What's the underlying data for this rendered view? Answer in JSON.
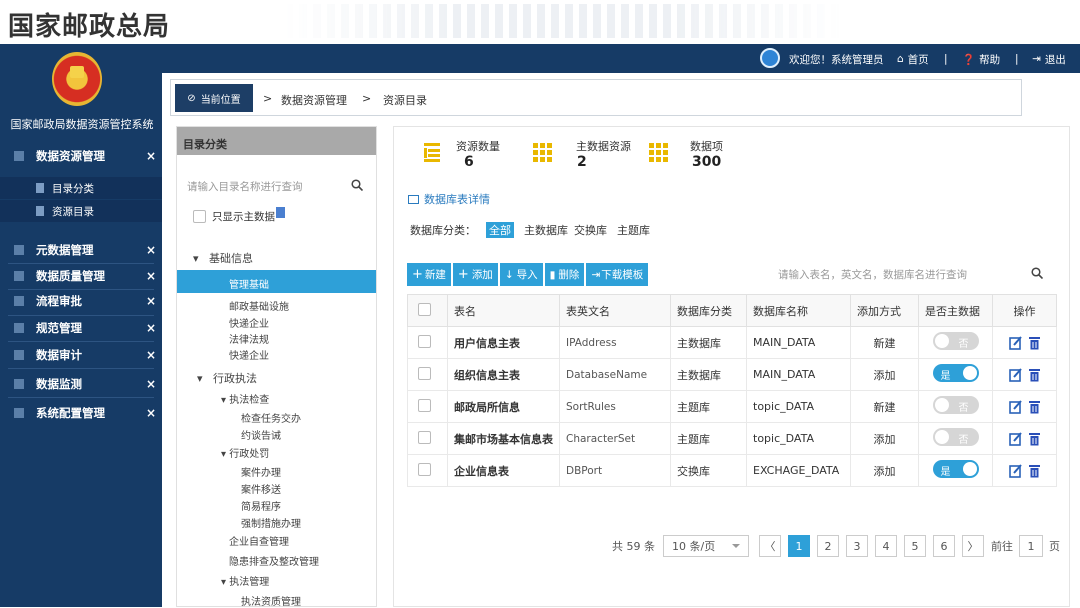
{
  "banner": {
    "title": "国家邮政总局"
  },
  "sidebar": {
    "system_name": "国家邮政局数据资源管控系统",
    "menus": [
      {
        "label": "数据资源管理",
        "close": "×"
      },
      {
        "label": "元数据管理",
        "close": "×"
      },
      {
        "label": "数据质量管理",
        "close": "×"
      },
      {
        "label": "流程审批",
        "close": "×"
      },
      {
        "label": "规范管理",
        "close": "×"
      },
      {
        "label": "数据审计",
        "close": "×"
      },
      {
        "label": "数据监测",
        "close": "×"
      },
      {
        "label": "系统配置管理",
        "close": "×"
      }
    ],
    "submenus": [
      {
        "label": "目录分类"
      },
      {
        "label": "资源目录"
      }
    ]
  },
  "topbar": {
    "welcome": "欢迎您！系统管理员",
    "home": "首页",
    "help": "帮助",
    "logout": "退出",
    "sep": "|"
  },
  "breadcrumb": {
    "current_label": "当前位置",
    "items": [
      "数据资源管理",
      "资源目录"
    ],
    "sep": ">"
  },
  "tree": {
    "title": "目录分类",
    "search_placeholder": "请输入目录名称进行查询",
    "only_main_label": "只显示主数据",
    "nodes": [
      {
        "label": "基础信息"
      },
      {
        "label": "管理基础"
      },
      {
        "label": "邮政基础设施"
      },
      {
        "label": "快递企业"
      },
      {
        "label": "法律法规"
      },
      {
        "label": "快递企业"
      },
      {
        "label": "行政执法"
      },
      {
        "label": "执法检查"
      },
      {
        "label": "检查任务交办"
      },
      {
        "label": "约谈告诫"
      },
      {
        "label": "行政处罚"
      },
      {
        "label": "案件办理"
      },
      {
        "label": "案件移送"
      },
      {
        "label": "简易程序"
      },
      {
        "label": "强制措施办理"
      },
      {
        "label": "企业自查管理"
      },
      {
        "label": "隐患排查及整改管理"
      },
      {
        "label": "执法管理"
      },
      {
        "label": "执法资质管理"
      }
    ]
  },
  "stats": [
    {
      "label": "资源数量",
      "value": "6"
    },
    {
      "label": "主数据资源",
      "value": "2"
    },
    {
      "label": "数据项",
      "value": "300"
    }
  ],
  "detail_title": "数据库表详情",
  "filter": {
    "label": "数据库分类：",
    "options": [
      "全部",
      "主数据库",
      "交换库",
      "主题库"
    ]
  },
  "toolbar": {
    "new": "新建",
    "add": "添加",
    "import": "导入",
    "delete": "删除",
    "download": "下载模板"
  },
  "table": {
    "search_placeholder": "请输入表名，英文名，数据库名进行查询",
    "columns": [
      "表名",
      "表英文名",
      "数据库分类",
      "数据库名称",
      "添加方式",
      "是否主数据",
      "操作"
    ],
    "rows": [
      {
        "name": "用户信息主表",
        "en": "IPAddress",
        "cat": "主数据库",
        "db": "MAIN_DATA",
        "method": "新建",
        "main": "否",
        "main_on": false
      },
      {
        "name": "组织信息主表",
        "en": "DatabaseName",
        "cat": "主数据库",
        "db": "MAIN_DATA",
        "method": "添加",
        "main": "是",
        "main_on": true
      },
      {
        "name": "邮政局所信息",
        "en": "SortRules",
        "cat": "主题库",
        "db": "topic_DATA",
        "method": "新建",
        "main": "否",
        "main_on": false
      },
      {
        "name": "集邮市场基本信息表",
        "en": "CharacterSet",
        "cat": "主题库",
        "db": "topic_DATA",
        "method": "添加",
        "main": "否",
        "main_on": false
      },
      {
        "name": "企业信息表",
        "en": "DBPort",
        "cat": "交换库",
        "db": "EXCHAGE_DATA",
        "method": "添加",
        "main": "是",
        "main_on": true
      }
    ]
  },
  "pager": {
    "total": "共 59 条",
    "page_size": "10 条/页",
    "pages": [
      "1",
      "2",
      "3",
      "4",
      "5",
      "6"
    ],
    "goto_label": "前往",
    "goto_value": "1",
    "page_unit": "页",
    "prev": "〈",
    "next": "〉"
  },
  "colors": {
    "navy": "#163b66",
    "accent": "#2ea0d8",
    "stat_icon": "#e9b800"
  }
}
